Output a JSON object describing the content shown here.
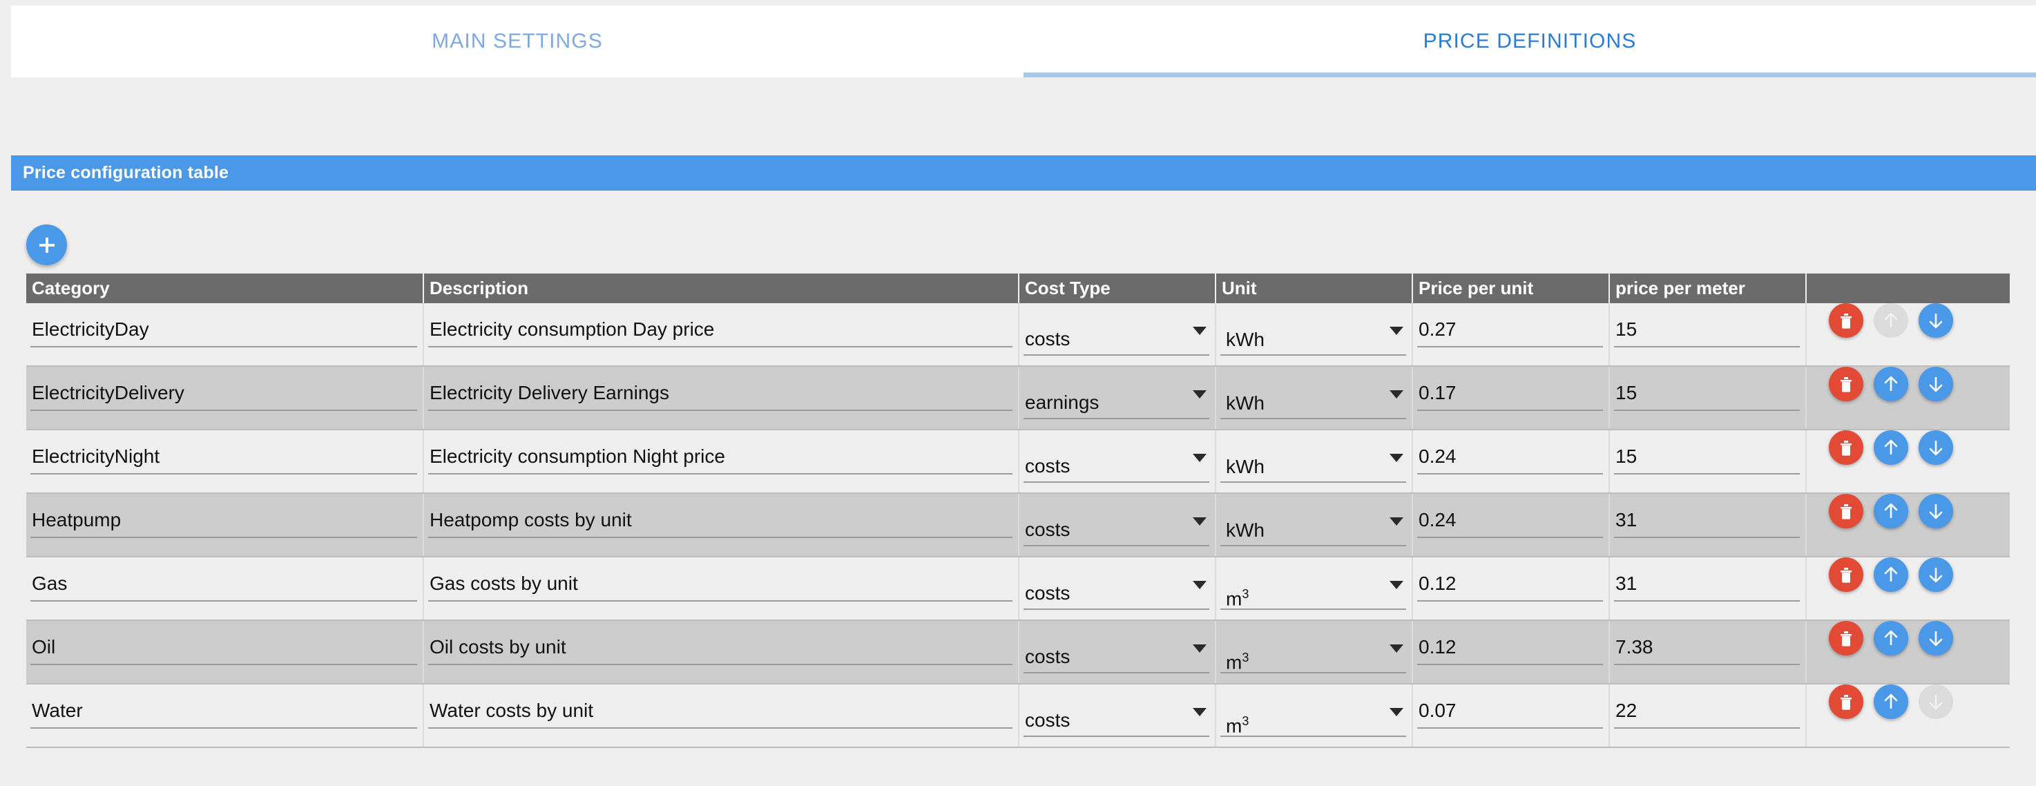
{
  "tabs": [
    {
      "label": "MAIN SETTINGS",
      "active": false,
      "name": "tab-main-settings"
    },
    {
      "label": "PRICE DEFINITIONS",
      "active": true,
      "name": "tab-price-definitions"
    }
  ],
  "panel": {
    "title": "Price configuration table",
    "header_bg": "#4a98e8",
    "header_text_color": "#ffffff"
  },
  "add_button": {
    "icon": "plus-icon",
    "color": "#4a98e8"
  },
  "table": {
    "columns": [
      "Category",
      "Description",
      "Cost Type",
      "Unit",
      "Price per unit",
      "price per meter",
      ""
    ],
    "header_bg": "#6b6b6b",
    "cost_type_options": [
      "costs",
      "earnings"
    ],
    "unit_options": [
      "kWh",
      "m³"
    ],
    "rows": [
      {
        "category": "ElectricityDay",
        "description": "Electricity consumption Day price",
        "cost_type": "costs",
        "unit": "kWh",
        "unit_base": "kWh",
        "unit_sup": "",
        "price_per_unit": "0.27",
        "price_per_meter": "15",
        "up_enabled": false,
        "down_enabled": true
      },
      {
        "category": "ElectricityDelivery",
        "description": "Electricity Delivery Earnings",
        "cost_type": "earnings",
        "unit": "kWh",
        "unit_base": "kWh",
        "unit_sup": "",
        "price_per_unit": "0.17",
        "price_per_meter": "15",
        "up_enabled": true,
        "down_enabled": true
      },
      {
        "category": "ElectricityNight",
        "description": "Electricity consumption Night price",
        "cost_type": "costs",
        "unit": "kWh",
        "unit_base": "kWh",
        "unit_sup": "",
        "price_per_unit": "0.24",
        "price_per_meter": "15",
        "up_enabled": true,
        "down_enabled": true
      },
      {
        "category": "Heatpump",
        "description": "Heatpomp costs by unit",
        "cost_type": "costs",
        "unit": "kWh",
        "unit_base": "kWh",
        "unit_sup": "",
        "price_per_unit": "0.24",
        "price_per_meter": "31",
        "up_enabled": true,
        "down_enabled": true
      },
      {
        "category": "Gas",
        "description": "Gas costs by unit",
        "cost_type": "costs",
        "unit": "m³",
        "unit_base": "m",
        "unit_sup": "3",
        "price_per_unit": "0.12",
        "price_per_meter": "31",
        "up_enabled": true,
        "down_enabled": true
      },
      {
        "category": "Oil",
        "description": "Oil costs by unit",
        "cost_type": "costs",
        "unit": "m³",
        "unit_base": "m",
        "unit_sup": "3",
        "price_per_unit": "0.12",
        "price_per_meter": "7.38",
        "up_enabled": true,
        "down_enabled": true
      },
      {
        "category": "Water",
        "description": "Water costs by unit",
        "cost_type": "costs",
        "unit": "m³",
        "unit_base": "m",
        "unit_sup": "3",
        "price_per_unit": "0.07",
        "price_per_meter": "22",
        "up_enabled": true,
        "down_enabled": false
      }
    ],
    "action_icons": {
      "delete": "trash-icon",
      "move_up": "arrow-up-icon",
      "move_down": "arrow-down-icon"
    },
    "action_colors": {
      "delete": "#e24a36",
      "move": "#4a98e8",
      "disabled": "#dcdcdc"
    }
  }
}
